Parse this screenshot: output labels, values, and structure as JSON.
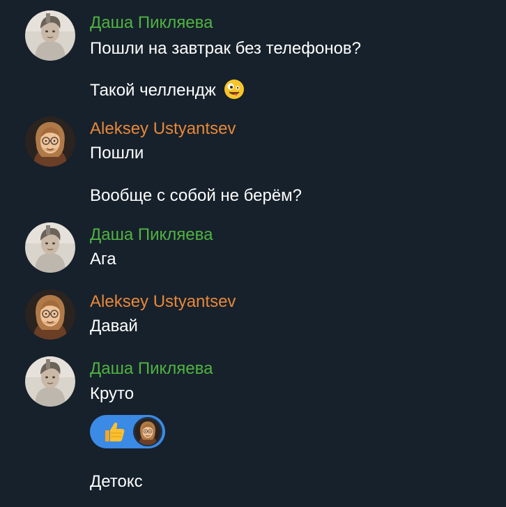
{
  "colors": {
    "background": "#17212b",
    "sender_dasha": "#4fb342",
    "sender_aleksey": "#e8883a",
    "message_text": "#ffffff",
    "reaction_bg": "#3b8ae6"
  },
  "messages": [
    {
      "sender": "Даша Пикляева",
      "avatar_icon": "photo-avatar-dasha",
      "lines": [
        "Пошли на завтрак без телефонов?",
        "Такой челлендж"
      ],
      "emoji": "zany-face-emoji"
    },
    {
      "sender": "Aleksey Ustyantsev",
      "avatar_icon": "memoji-avatar-aleksey",
      "lines": [
        "Пошли",
        "Вообще с собой не берём?"
      ]
    },
    {
      "sender": "Даша Пикляева",
      "avatar_icon": "photo-avatar-dasha",
      "lines": [
        "Ага"
      ]
    },
    {
      "sender": "Aleksey Ustyantsev",
      "avatar_icon": "memoji-avatar-aleksey",
      "lines": [
        "Давай"
      ]
    },
    {
      "sender": "Даша Пикляева",
      "avatar_icon": "photo-avatar-dasha",
      "lines": [
        "Круто",
        "Детокс"
      ],
      "reaction": {
        "emoji": "thumbs-up-icon",
        "count_avatars": 1
      }
    }
  ]
}
